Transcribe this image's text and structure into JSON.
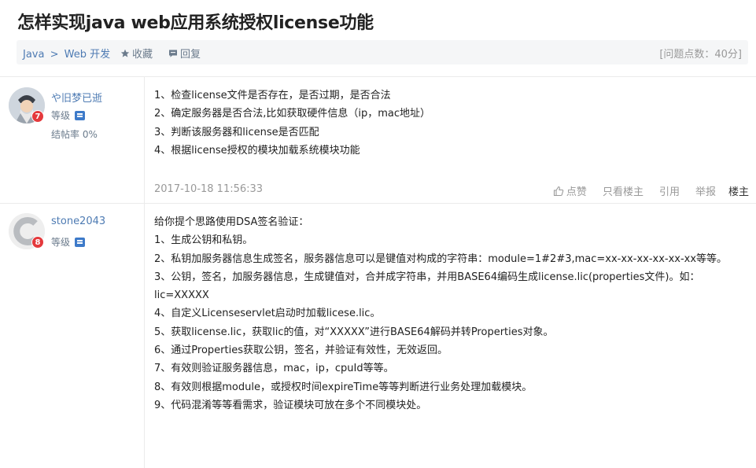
{
  "title": "怎样实现java web应用系统授权license功能",
  "toolbar": {
    "breadcrumb_java": "Java",
    "breadcrumb_sep": ">",
    "breadcrumb_web": "Web 开发",
    "favorite_label": "收藏",
    "reply_label": "回复",
    "points": "[问题点数：40分]"
  },
  "posts": [
    {
      "username": "や旧梦已逝",
      "level_label": "等级",
      "badge": "7",
      "rate": "结帖率 0%",
      "lines": [
        "1、检查license文件是否存在，是否过期，是否合法",
        "2、确定服务器是否合法,比如获取硬件信息（ip，mac地址）",
        "3、判断该服务器和license是否匹配",
        "4、根据license授权的模块加载系统模块功能"
      ],
      "date": "2017-10-18 11:56:33",
      "actions": {
        "like": "点赞",
        "only_author": "只看楼主",
        "quote": "引用",
        "report": "举报",
        "floor": "楼主"
      }
    },
    {
      "username": "stone2043",
      "level_label": "等级",
      "badge": "8",
      "lines": [
        "给你提个思路使用DSA签名验证：",
        "1、生成公钥和私钥。",
        "2、私钥加服务器信息生成签名，服务器信息可以是键值对构成的字符串：module=1#2#3,mac=xx-xx-xx-xx-xx-xx等等。",
        "3、公钥，签名，加服务器信息，生成键值对，合并成字符串，并用BASE64编码生成license.lic(properties文件)。如：",
        "lic=XXXXX",
        "4、自定义Licenseservlet启动时加载licese.lic。",
        "5、获取license.lic，获取lic的值，对“XXXXX”进行BASE64解码并转Properties对象。",
        "6、通过Properties获取公钥，签名，并验证有效性，无效返回。",
        "7、有效则验证服务器信息，mac，ip，cpuId等等。",
        "8、有效则根据module，或授权时间expireTime等等判断进行业务处理加载模块。",
        "9、代码混淆等等看需求，验证模块可放在多个不同模块处。"
      ]
    }
  ]
}
